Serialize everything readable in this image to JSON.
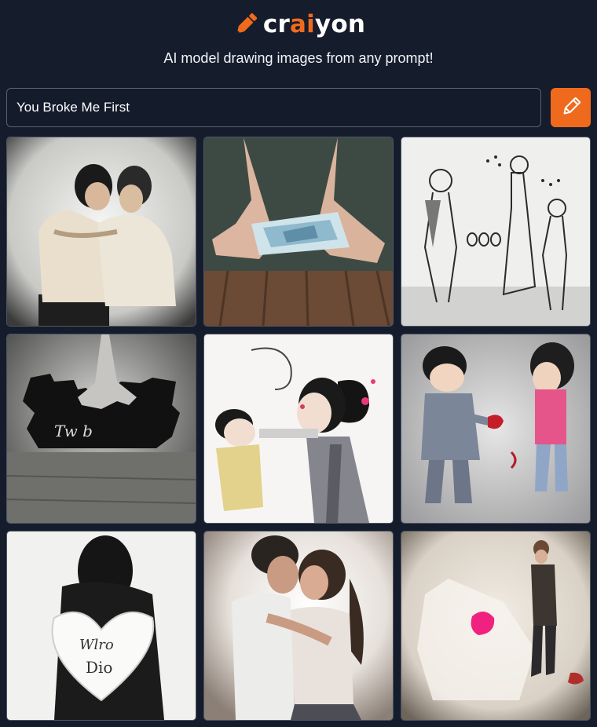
{
  "header": {
    "logo": {
      "prefix": "cr",
      "highlight": "ai",
      "suffix": "yon",
      "icon": "pencil-icon",
      "accent_color": "#f06a1d"
    },
    "tagline": "AI model drawing images from any prompt!"
  },
  "prompt": {
    "value": "You Broke Me First",
    "button_icon": "pencil-icon",
    "button_color": "#f06a1d"
  },
  "results": [
    {
      "subject": "couple-embrace"
    },
    {
      "subject": "hands-holding-paper"
    },
    {
      "subject": "sketch-figures"
    },
    {
      "subject": "hand-broken-wall"
    },
    {
      "subject": "cartoon-couple"
    },
    {
      "subject": "cartoon-boy-heart"
    },
    {
      "subject": "woman-holding-heart"
    },
    {
      "subject": "couple-kissing"
    },
    {
      "subject": "man-pink-heart"
    }
  ],
  "colors": {
    "background": "#151c2c",
    "input_border": "#5b6373"
  }
}
